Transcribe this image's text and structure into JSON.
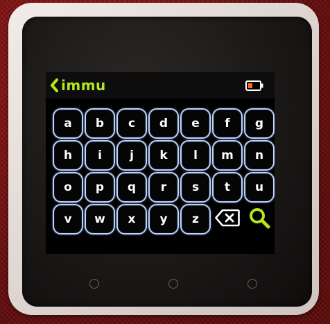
{
  "header": {
    "title": "immu",
    "back_icon": "chevron-left-icon",
    "battery_icon": "battery-low-icon",
    "accent_color": "#b5e61d",
    "battery_color": "#ff6a1a"
  },
  "keyboard": {
    "rows": [
      [
        "a",
        "b",
        "c",
        "d",
        "e",
        "f",
        "g"
      ],
      [
        "h",
        "i",
        "j",
        "k",
        "l",
        "m",
        "n"
      ],
      [
        "o",
        "p",
        "q",
        "r",
        "s",
        "t",
        "u"
      ],
      [
        "v",
        "w",
        "x",
        "y",
        "z"
      ]
    ],
    "backspace_icon": "backspace-icon",
    "search_icon": "search-icon",
    "key_border_color": "#bcd3ff"
  },
  "hardware_buttons": [
    "button-a",
    "button-b",
    "button-c"
  ]
}
